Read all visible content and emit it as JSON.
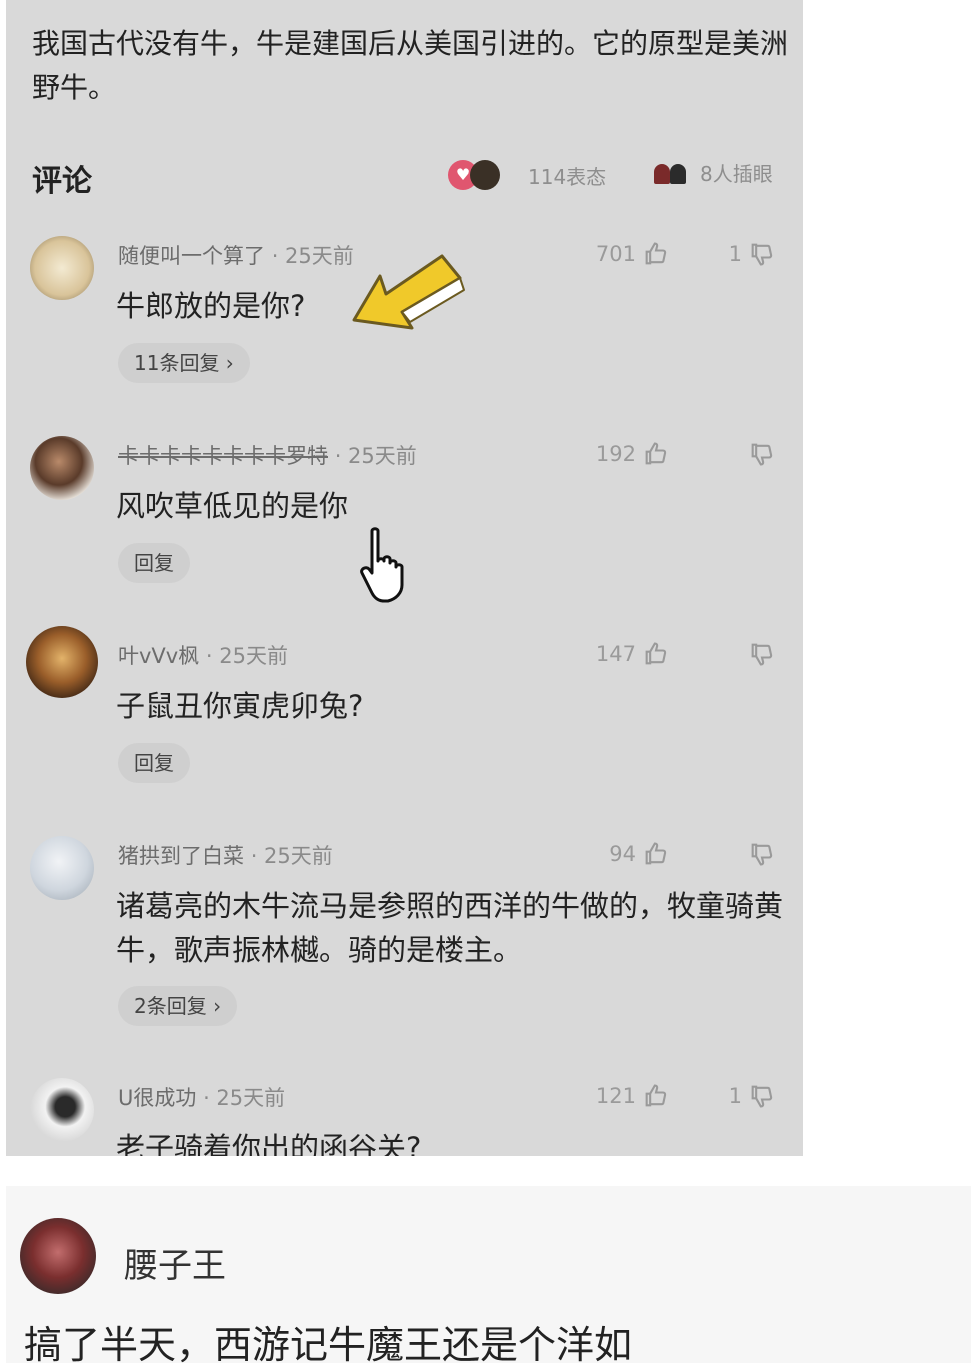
{
  "post": {
    "text": "我国古代没有牛，牛是建国后从美国引进的。它的原型是美洲野牛。"
  },
  "comments_header": {
    "title": "评论",
    "reactions_count": "114表态",
    "peek_count": "8人插眼"
  },
  "comments": [
    {
      "username": "随便叫一个算了",
      "time": "· 25天前",
      "text": "牛郎放的是你?",
      "likes": "701",
      "dislikes": "1",
      "replies_label": "11条回复 ›"
    },
    {
      "username": "卡卡卡卡卡卡卡卡罗特",
      "time": "· 25天前",
      "text": "风吹草低见的是你",
      "likes": "192",
      "dislikes": "",
      "replies_label": "回复"
    },
    {
      "username": "叶vVv枫",
      "time": "· 25天前",
      "text": "子鼠丑你寅虎卯兔?",
      "likes": "147",
      "dislikes": "",
      "replies_label": "回复"
    },
    {
      "username": "猪拱到了白菜",
      "time": "· 25天前",
      "text": "诸葛亮的木牛流马是参照的西洋的牛做的，牧童骑黄牛，歌声振林樾。骑的是楼主。",
      "likes": "94",
      "dislikes": "",
      "replies_label": "2条回复 ›"
    },
    {
      "username": "U很成功",
      "time": "· 25天前",
      "text": "老子骑着你出的函谷关?",
      "likes": "121",
      "dislikes": "1",
      "replies_label": ""
    }
  ],
  "bottom_comment": {
    "username": "腰子王",
    "text": "搞了半天，西游记牛魔王还是个洋如"
  },
  "icons": {
    "like": "thumbs-up-icon",
    "dislike": "thumbs-down-icon",
    "reaction": "reaction-emoji-icon",
    "peek": "peek-eye-icon",
    "arrow": "yellow-arrow-icon",
    "cursor": "hand-cursor-icon"
  }
}
